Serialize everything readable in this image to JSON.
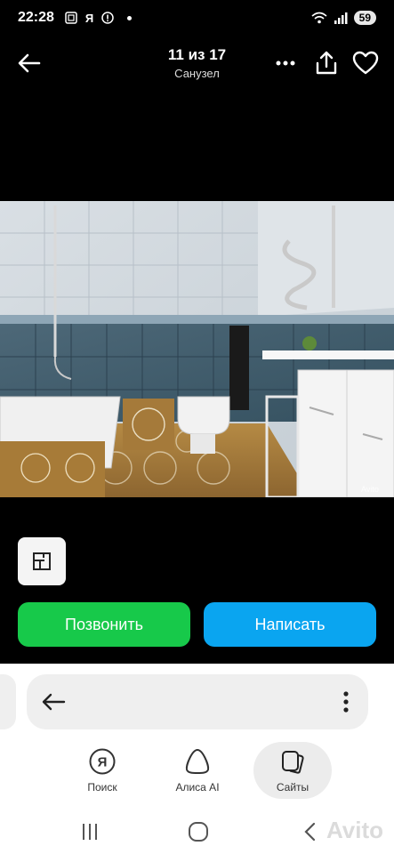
{
  "status_bar": {
    "time": "22:28",
    "icons_left": [
      "screenshot-icon",
      "yandex-icon",
      "shield-icon",
      "dot-icon"
    ],
    "yandex_letter": "Я",
    "battery": "59"
  },
  "header": {
    "counter": "11 из 17",
    "photo_label": "Санузел"
  },
  "photo": {
    "watermark": "Avito"
  },
  "actions": {
    "call_label": "Позвонить",
    "write_label": "Написать",
    "call_color": "#17c94a",
    "write_color": "#0aa5f0"
  },
  "browser_nav": {
    "search_label": "Поиск",
    "search_letter": "Я",
    "alice_label": "Алиса AI",
    "sites_label": "Сайты"
  },
  "system_nav": {
    "watermark": "Avito"
  }
}
